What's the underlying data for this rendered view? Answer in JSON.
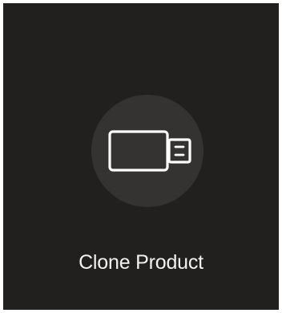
{
  "tile": {
    "label": "Clone Product",
    "icon": "usb-drive-icon",
    "colors": {
      "background": "#221f1f",
      "circle": "#353232",
      "foreground": "#ffffff",
      "text": "#f2f2f2"
    }
  }
}
